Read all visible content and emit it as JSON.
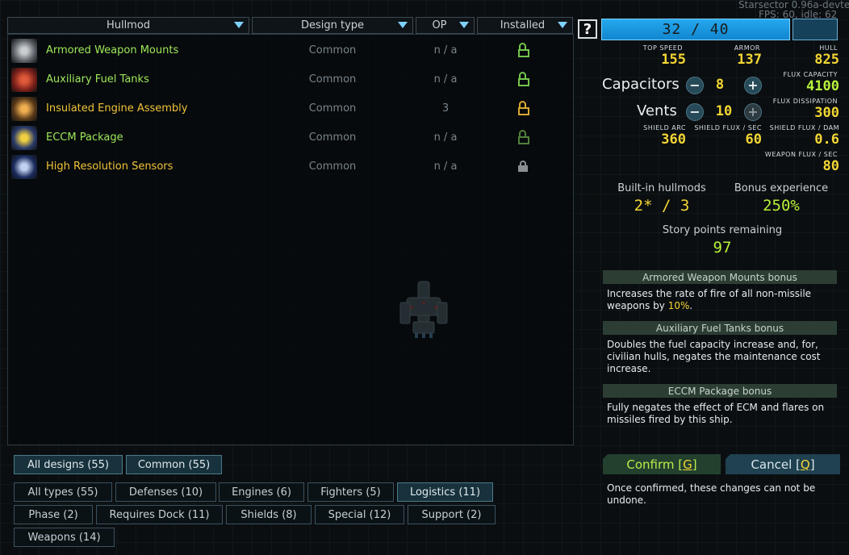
{
  "dev": {
    "line1": "Starsector 0.96a-dev",
    "line1_tail": "te",
    "line2": "FPS:  60, idle: ",
    "line2_tail": "62"
  },
  "list": {
    "columns": {
      "hullmod": "Hullmod",
      "design_type": "Design type",
      "op": "OP",
      "installed": "Installed"
    },
    "rows": [
      {
        "name": "Armored Weapon Mounts",
        "design": "Common",
        "op": "n / a",
        "color": "#9ee85a",
        "lock": "open",
        "lock_color": "#74c44b",
        "thumb": "armor-mount-icon"
      },
      {
        "name": "Auxiliary Fuel Tanks",
        "design": "Common",
        "op": "n / a",
        "color": "#9ee85a",
        "lock": "open",
        "lock_color": "#74c44b",
        "thumb": "fuel-tank-icon"
      },
      {
        "name": "Insulated Engine Assembly",
        "design": "Common",
        "op": "3",
        "color": "#f0c33a",
        "lock": "open",
        "lock_color": "#d5a832",
        "thumb": "engine-icon"
      },
      {
        "name": "ECCM Package",
        "design": "Common",
        "op": "n / a",
        "color": "#9ee85a",
        "lock": "open",
        "lock_color": "#52803a",
        "thumb": "eccm-icon"
      },
      {
        "name": "High Resolution Sensors",
        "design": "Common",
        "op": "n / a",
        "color": "#f0c33a",
        "lock": "closed",
        "lock_color": "#8a8f92",
        "thumb": "sensor-icon"
      }
    ]
  },
  "filters": {
    "designs": [
      {
        "label": "All designs (55)",
        "active": true
      },
      {
        "label": "Common (55)",
        "active": true
      }
    ],
    "types": [
      {
        "label": "All types (55)",
        "active": false
      },
      {
        "label": "Defenses (10)",
        "active": false
      },
      {
        "label": "Engines (6)",
        "active": false
      },
      {
        "label": "Fighters (5)",
        "active": false
      },
      {
        "label": "Logistics (11)",
        "active": true
      },
      {
        "label": "Phase (2)",
        "active": false
      },
      {
        "label": "Requires Dock (11)",
        "active": false
      },
      {
        "label": "Shields (8)",
        "active": false
      },
      {
        "label": "Special (12)",
        "active": false
      },
      {
        "label": "Support (2)",
        "active": false
      },
      {
        "label": "Weapons (14)",
        "active": false
      }
    ]
  },
  "stats": {
    "help": "?",
    "op_display": "32 / 40",
    "top_speed_label": "TOP SPEED",
    "top_speed": "155",
    "armor_label": "ARMOR",
    "armor": "137",
    "hull_label": "HULL",
    "hull": "825",
    "capacitors_label": "Capacitors",
    "capacitors": "8",
    "flux_capacity_label": "FLUX CAPACITY",
    "flux_capacity": "4100",
    "vents_label": "Vents",
    "vents": "10",
    "flux_dissipation_label": "FLUX DISSIPATION",
    "flux_dissipation": "300",
    "minus": "−",
    "plus": "+",
    "shield_arc_label": "SHIELD ARC",
    "shield_arc": "360",
    "shield_flux_sec_label": "SHIELD FLUX / SEC",
    "shield_flux_sec": "60",
    "shield_flux_dam_label": "SHIELD FLUX / DAM",
    "shield_flux_dam": "0.6",
    "weapon_flux_label": "WEAPON FLUX / SEC",
    "weapon_flux": "80",
    "builtin_label": "Built-in hullmods",
    "builtin_value": "2* / 3",
    "bonus_xp_label": "Bonus experience",
    "bonus_xp_value": "250%",
    "story_label": "Story points remaining",
    "story_value": "97"
  },
  "bonuses": [
    {
      "title": "Armored Weapon Mounts bonus",
      "text": "Increases the rate of fire of all non-missile weapons by ",
      "highlight": "10%",
      "tail": "."
    },
    {
      "title": "Auxiliary Fuel Tanks bonus",
      "text": "Doubles the fuel capacity increase and, for, civilian hulls, negates the maintenance cost increase.",
      "highlight": "",
      "tail": ""
    },
    {
      "title": "ECCM Package bonus",
      "text": "Fully negates the effect of ECM and flares on missiles fired by this ship.",
      "highlight": "",
      "tail": ""
    }
  ],
  "actions": {
    "confirm_pre": "Confirm [",
    "confirm_key": "G",
    "confirm_post": "]",
    "cancel_pre": "Cancel [",
    "cancel_key": "Q",
    "cancel_post": "]",
    "note": "Once confirmed, these changes can not be undone."
  }
}
